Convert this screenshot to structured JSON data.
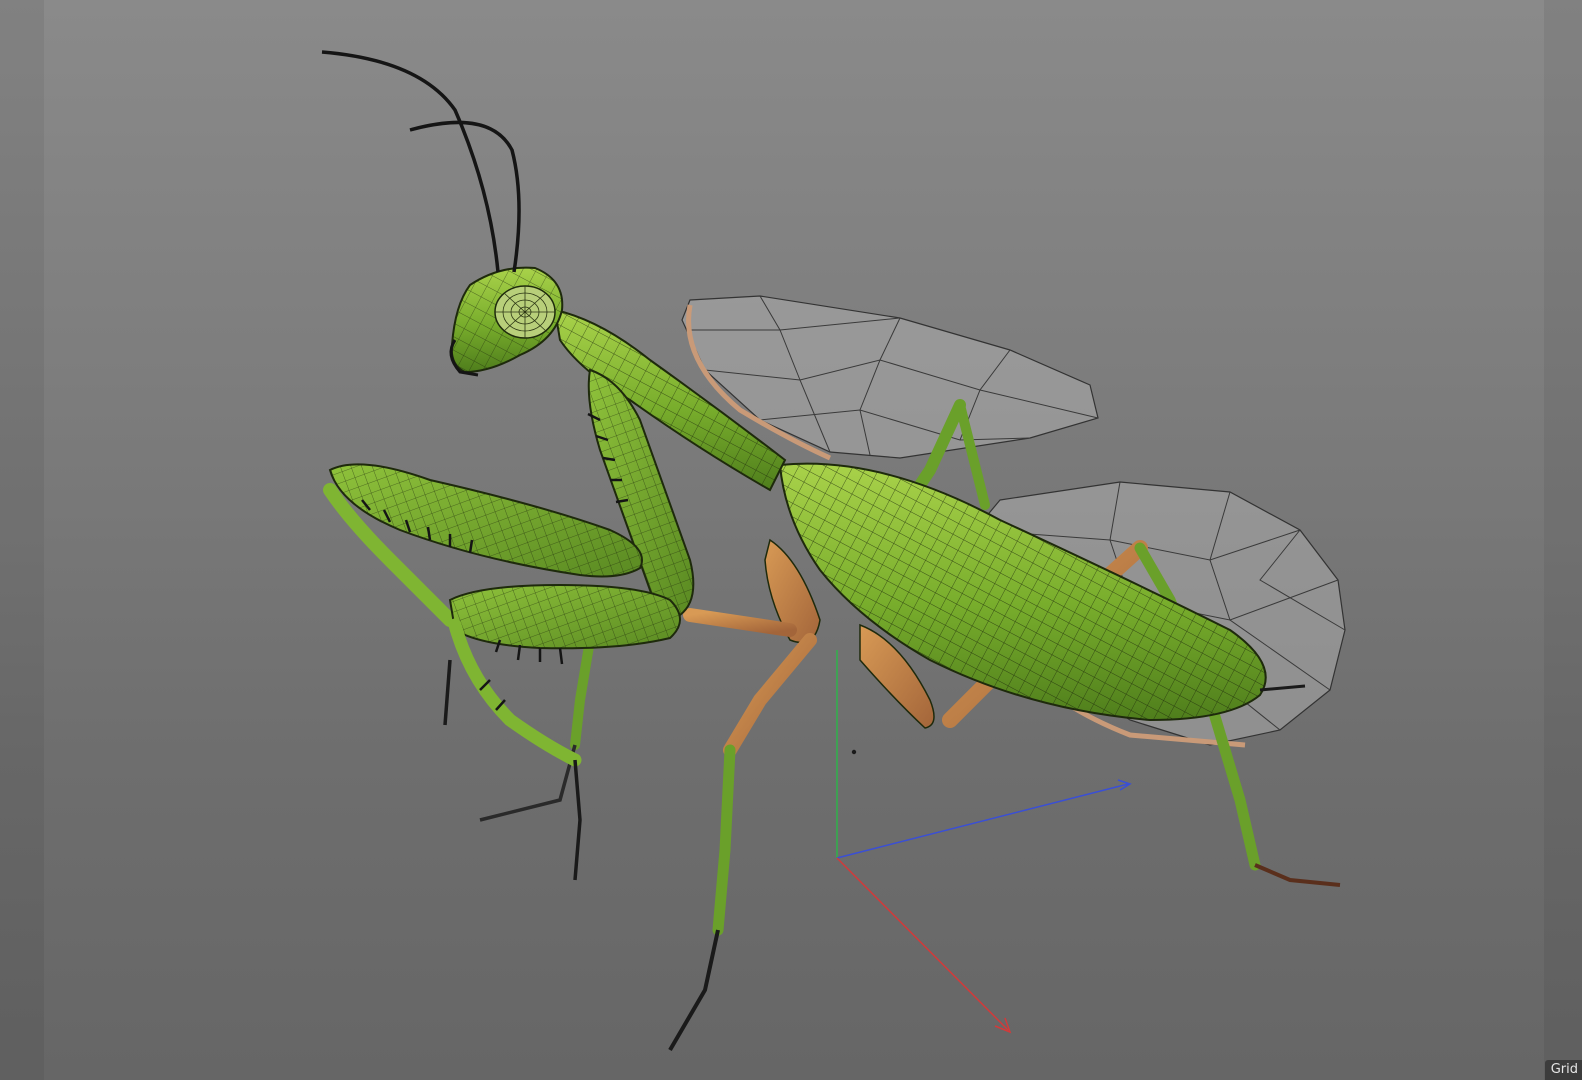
{
  "viewport": {
    "overlay_label": "Grid"
  },
  "scene": {
    "object": "praying-mantis-wireframe-model",
    "colors": {
      "body_green": "#6fa52a",
      "body_light": "#9cc93e",
      "leg_orange": "#c8874a",
      "wire": "#1e2a0c",
      "antenna": "#151515",
      "wing_wire": "#3a3a3a",
      "wing_fill": "#b8b8b8"
    },
    "gizmo": {
      "x_axis_color": "#d33a3a",
      "y_axis_color": "#2fb24a",
      "z_axis_color": "#3a4fd6"
    }
  }
}
